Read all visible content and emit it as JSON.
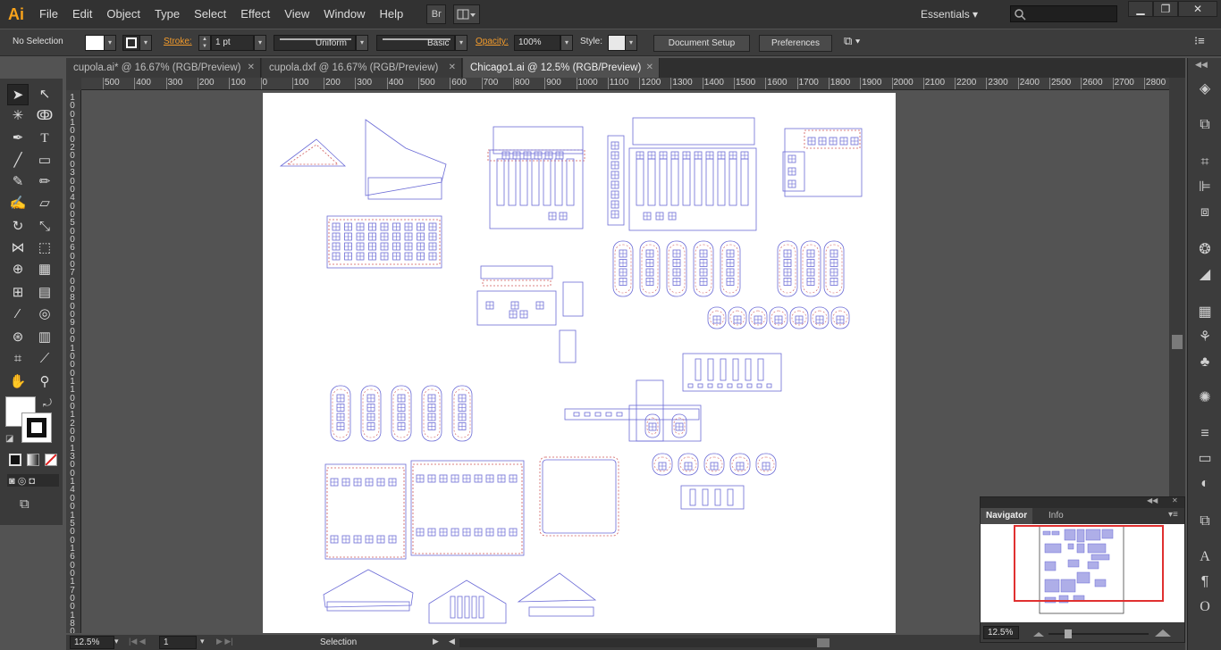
{
  "menubar": {
    "app_logo": "Ai",
    "items": [
      "File",
      "Edit",
      "Object",
      "Type",
      "Select",
      "Effect",
      "View",
      "Window",
      "Help"
    ],
    "bridge_label": "Br",
    "workspace": "Essentials",
    "search_placeholder": ""
  },
  "window_controls": {
    "minimize": "▁",
    "restore": "❐",
    "close": "✕"
  },
  "controlbar": {
    "selection_state": "No Selection",
    "stroke_label": "Stroke:",
    "stroke_weight": "1 pt",
    "variable_width_profile": "Uniform",
    "brush_definition": "Basic",
    "opacity_label": "Opacity:",
    "opacity_value": "100%",
    "style_label": "Style:",
    "document_setup": "Document Setup",
    "preferences": "Preferences"
  },
  "tabs": [
    {
      "label": "cupola.ai* @ 16.67% (RGB/Preview)",
      "active": false
    },
    {
      "label": "cupola.dxf @ 16.67% (RGB/Preview)",
      "active": false
    },
    {
      "label": "Chicago1.ai @ 12.5% (RGB/Preview)",
      "active": true
    }
  ],
  "ruler_top": [
    "500",
    "400",
    "300",
    "200",
    "100",
    "0",
    "100",
    "200",
    "300",
    "400",
    "500",
    "600",
    "700",
    "800",
    "900",
    "1000",
    "1100",
    "1200",
    "1300",
    "1400",
    "1500",
    "1600",
    "1700",
    "1800",
    "1900",
    "2000",
    "2100",
    "2200",
    "2300",
    "2400",
    "2500",
    "2600",
    "2700",
    "2800"
  ],
  "ruler_left": [
    "1",
    "0",
    "0",
    "1",
    "0",
    "0",
    "2",
    "0",
    "0",
    "3",
    "0",
    "0",
    "4",
    "0",
    "0",
    "5",
    "0",
    "0",
    "6",
    "0",
    "0",
    "7",
    "0",
    "0",
    "8",
    "0",
    "0",
    "9",
    "0",
    "0",
    "1",
    "0",
    "0",
    "0",
    "1",
    "1",
    "0",
    "0",
    "1",
    "2",
    "0",
    "0",
    "1",
    "3",
    "0",
    "0",
    "1",
    "4",
    "0",
    "0",
    "1",
    "5",
    "0",
    "0",
    "1",
    "6",
    "0",
    "0",
    "1",
    "7",
    "0",
    "0",
    "1",
    "8",
    "0",
    "0"
  ],
  "statusbar": {
    "zoom": "12.5%",
    "artboard_number": "1",
    "current_tool": "Selection"
  },
  "navigator": {
    "tabs": [
      "Navigator",
      "Info"
    ],
    "zoom": "12.5%"
  },
  "colors": {
    "accent_orange": "#f39b2b",
    "line_blue": "#6b6bd6",
    "line_red": "#d05a5a",
    "nav_frame": "#e03030"
  }
}
